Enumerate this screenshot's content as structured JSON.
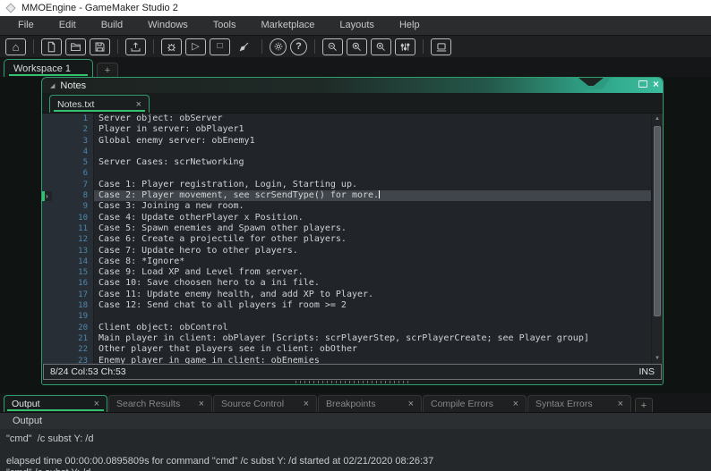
{
  "window": {
    "title": "MMOEngine - GameMaker Studio 2"
  },
  "menu": {
    "items": [
      "File",
      "Edit",
      "Build",
      "Windows",
      "Tools",
      "Marketplace",
      "Layouts",
      "Help"
    ]
  },
  "toolbar": {
    "icons": [
      "home",
      "new-file",
      "open-project",
      "save-project",
      "export-project",
      "debug",
      "run",
      "stop",
      "clean",
      "settings",
      "help",
      "zoom-out",
      "zoom-reset",
      "zoom-in",
      "game-options",
      "target-manager"
    ]
  },
  "workspace": {
    "tab_label": "Workspace 1",
    "add_label": "+"
  },
  "notes_window": {
    "title": "Notes",
    "tab": {
      "label": "Notes.txt"
    },
    "editor": {
      "current_line": 8,
      "status_left": "8/24 Col:53 Ch:53",
      "status_right": "INS",
      "lines": [
        {
          "n": 1,
          "text": "Server object: obServer"
        },
        {
          "n": 2,
          "text": "Player in server: obPlayer1"
        },
        {
          "n": 3,
          "text": "Global enemy server: obEnemy1"
        },
        {
          "n": 4,
          "text": ""
        },
        {
          "n": 5,
          "text": "Server Cases: scrNetworking"
        },
        {
          "n": 6,
          "text": ""
        },
        {
          "n": 7,
          "text": "Case 1: Player registration, Login, Starting up."
        },
        {
          "n": 8,
          "text": "Case 2: Player movement, see scrSendType() for more.",
          "current": true,
          "cursor": true
        },
        {
          "n": 9,
          "text": "Case 3: Joining a new room."
        },
        {
          "n": 10,
          "text": "Case 4: Update otherPlayer x Position."
        },
        {
          "n": 11,
          "text": "Case 5: Spawn enemies and Spawn other players."
        },
        {
          "n": 12,
          "text": "Case 6: Create a projectile for other players."
        },
        {
          "n": 13,
          "text": "Case 7: Update hero to other players."
        },
        {
          "n": 14,
          "text": "Case 8: *Ignore*"
        },
        {
          "n": 15,
          "text": "Case 9: Load XP and Level from server."
        },
        {
          "n": 16,
          "text": "Case 10: Save choosen hero to a ini file."
        },
        {
          "n": 17,
          "text": "Case 11: Update enemy health, and add XP to Player."
        },
        {
          "n": 18,
          "text": "Case 12: Send chat to all players if room >= 2"
        },
        {
          "n": 19,
          "text": ""
        },
        {
          "n": 20,
          "text": "Client object: obControl"
        },
        {
          "n": 21,
          "text": "Main player in client: obPlayer [Scripts: scrPlayerStep, scrPlayerCreate; see Player group]"
        },
        {
          "n": 22,
          "text": "Other player that players see in client: obOther"
        },
        {
          "n": 23,
          "text": "Enemy player in game in client: obEnemies"
        }
      ]
    }
  },
  "bottom_panel": {
    "tabs": [
      {
        "label": "Output",
        "active": true
      },
      {
        "label": "Search Results"
      },
      {
        "label": "Source Control"
      },
      {
        "label": "Breakpoints"
      },
      {
        "label": "Compile Errors"
      },
      {
        "label": "Syntax Errors"
      }
    ],
    "add_label": "+",
    "header": "Output",
    "lines": [
      "\"cmd\"  /c subst Y: /d",
      "",
      "elapsed time 00:00:00.0895809s for command \"cmd\" /c subst Y: /d started at 02/21/2020 08:26:37",
      "\"cmd\" /c subst Y: /d"
    ]
  },
  "icons": {
    "close": "×",
    "marker": "›",
    "arrow_up": "▲",
    "arrow_down": "▼",
    "play": "▷",
    "stop": "□",
    "home": "⌂",
    "help": "?",
    "collapse": "◢"
  },
  "colors": {
    "accent_green": "#35c070",
    "window_border": "#2f9e6d",
    "teal": "#36b697",
    "editor_bg": "#212428",
    "gutter_bg": "#272e35",
    "line_number_blue": "#4e89ae",
    "current_line_bg": "#40454b",
    "titlebar_bg": "#ffffff",
    "menubar_bg": "#2a2c2e"
  }
}
